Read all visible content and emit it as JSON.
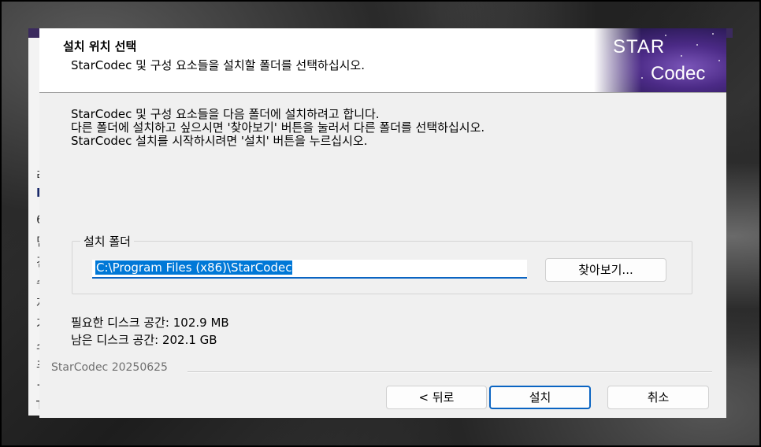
{
  "background_window": {
    "visible_glyphs": [
      "리",
      "D",
      "6",
      "딘",
      "견",
      "수",
      "저",
      "가",
      "소",
      "푸",
      "+",
      "T"
    ]
  },
  "dialog": {
    "header": {
      "title": "설치 위치 선택",
      "subtitle": "StarCodec 및 구성 요소들을 설치할 폴더를 선택하십시오.",
      "logo": {
        "line1": "STAR",
        "line2": "Codec",
        "colors": [
          "#2a1a55",
          "#4b2a86",
          "#7a55b8"
        ]
      }
    },
    "instructions": [
      "StarCodec 및 구성 요소들을 다음 폴더에 설치하려고 합니다.",
      "다른 폴더에 설치하고 싶으시면 '찾아보기' 버튼을 눌러서 다른 폴더를 선택하십시오.",
      "StarCodec 설치를 시작하시려면 '설치' 버튼을 누르십시오."
    ],
    "install_folder": {
      "group_label": "설치 폴더",
      "path": "C:\\Program Files (x86)\\StarCodec",
      "browse_label": "찾아보기..."
    },
    "space_required": "필요한 디스크 공간: 102.9 MB",
    "space_available": "남은 디스크 공간: 202.1 GB",
    "branding": "StarCodec 20250625",
    "buttons": {
      "back": "< 뒤로",
      "install": "설치",
      "cancel": "취소"
    },
    "accent_color": "#0a64c2"
  }
}
